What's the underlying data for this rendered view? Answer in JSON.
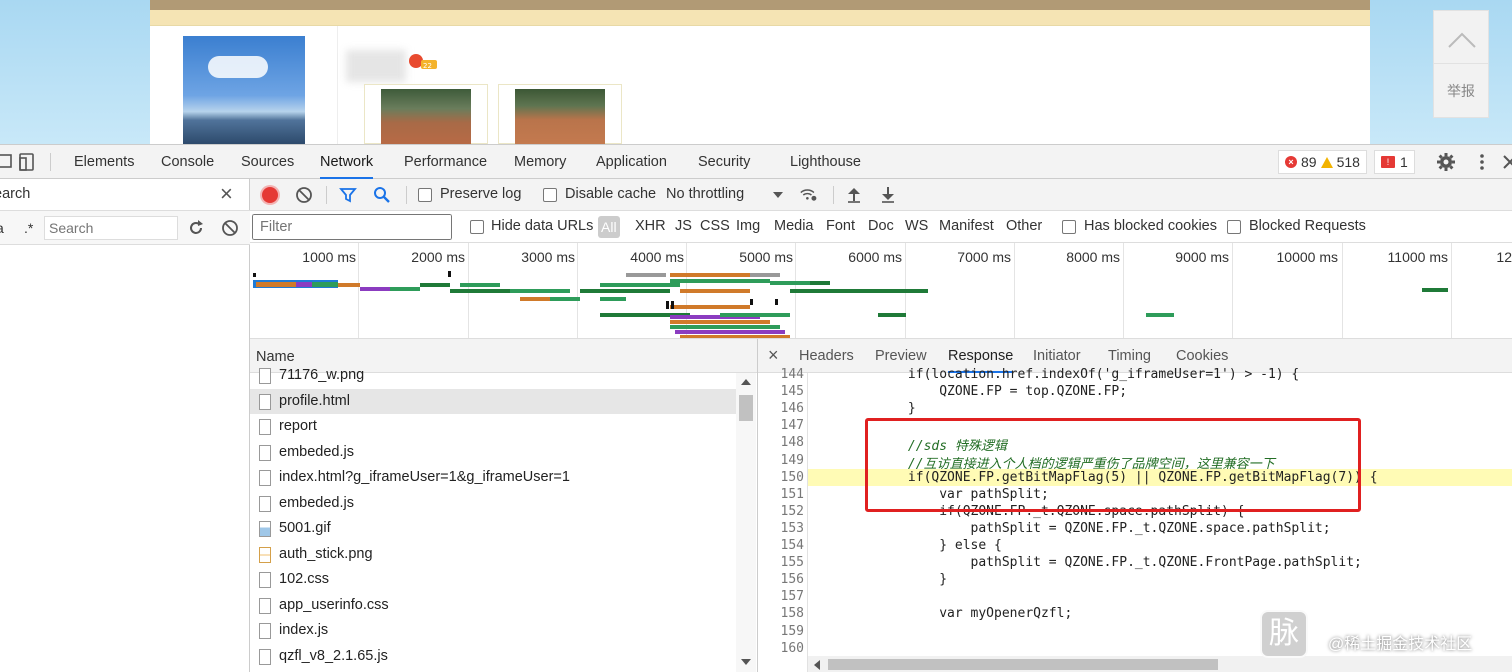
{
  "webpage": {
    "report_label": "举报"
  },
  "devtools": {
    "tabs": [
      "Elements",
      "Console",
      "Sources",
      "Network",
      "Performance",
      "Memory",
      "Application",
      "Security",
      "Lighthouse"
    ],
    "active_tab": "Network",
    "error_count": "89",
    "warning_count": "518",
    "issue_count": "1"
  },
  "search_panel": {
    "title": "earch",
    "aa_label": "a",
    "regex_label": ".*",
    "placeholder": "Search"
  },
  "network_toolbar": {
    "preserve_log": "Preserve log",
    "disable_cache": "Disable cache",
    "throttling": "No throttling"
  },
  "filter_bar": {
    "placeholder": "Filter",
    "hide_data_urls": "Hide data URLs",
    "all": "All",
    "types": [
      "XHR",
      "JS",
      "CSS",
      "Img",
      "Media",
      "Font",
      "Doc",
      "WS",
      "Manifest",
      "Other"
    ],
    "has_blocked_cookies": "Has blocked cookies",
    "blocked_requests": "Blocked Requests"
  },
  "timeline": {
    "labels": [
      "1000 ms",
      "2000 ms",
      "3000 ms",
      "4000 ms",
      "5000 ms",
      "6000 ms",
      "7000 ms",
      "8000 ms",
      "9000 ms",
      "10000 ms",
      "11000 ms",
      "12"
    ]
  },
  "request_list": {
    "header": "Name",
    "rows": [
      {
        "name": "71176_w.png",
        "type": "doc",
        "selected": false
      },
      {
        "name": "profile.html",
        "type": "doc",
        "selected": true
      },
      {
        "name": "report",
        "type": "doc",
        "selected": false
      },
      {
        "name": "embeded.js",
        "type": "doc",
        "selected": false
      },
      {
        "name": "index.html?g_iframeUser=1&g_iframeUser=1",
        "type": "doc",
        "selected": false
      },
      {
        "name": "embeded.js",
        "type": "doc",
        "selected": false
      },
      {
        "name": "5001.gif",
        "type": "gif",
        "selected": false
      },
      {
        "name": "auth_stick.png",
        "type": "png",
        "selected": false
      },
      {
        "name": "102.css",
        "type": "doc",
        "selected": false
      },
      {
        "name": "app_userinfo.css",
        "type": "doc",
        "selected": false
      },
      {
        "name": "index.js",
        "type": "doc",
        "selected": false
      },
      {
        "name": "qzfl_v8_2.1.65.js",
        "type": "doc",
        "selected": false
      }
    ]
  },
  "detail": {
    "tabs": [
      "Headers",
      "Preview",
      "Response",
      "Initiator",
      "Timing",
      "Cookies"
    ],
    "active_tab": "Response",
    "line_numbers": [
      "144",
      "145",
      "146",
      "147",
      "148",
      "149",
      "150",
      "151",
      "152",
      "153",
      "154",
      "155",
      "156",
      "157",
      "158",
      "159",
      "160"
    ],
    "highlight_line": "149",
    "code_lines": [
      "            if(location.href.indexOf('g_iframeUser=1') > -1) {",
      "                QZONE.FP = top.QZONE.FP;",
      "            }",
      "",
      "            //sds 特殊逻辑",
      "            //互访直接进入个人档的逻辑严重伤了品牌空间，这里兼容一下",
      "            if(QZONE.FP.getBitMapFlag(5) || QZONE.FP.getBitMapFlag(7)) {",
      "                var pathSplit;",
      "                if(QZONE.FP._t.QZONE.space.pathSplit) {",
      "                    pathSplit = QZONE.FP._t.QZONE.space.pathSplit;",
      "                } else {",
      "                    pathSplit = QZONE.FP._t.QZONE.FrontPage.pathSplit;",
      "                }",
      "",
      "                var myOpenerQzfl;",
      "",
      ""
    ]
  },
  "watermark": {
    "logo_char": "脉",
    "text": "@稀土掘金技术社区"
  },
  "colors": {
    "accent": "#1a73e8",
    "record": "#e53935",
    "highlight": "#fffbb5",
    "annotation_box": "#e02020"
  }
}
